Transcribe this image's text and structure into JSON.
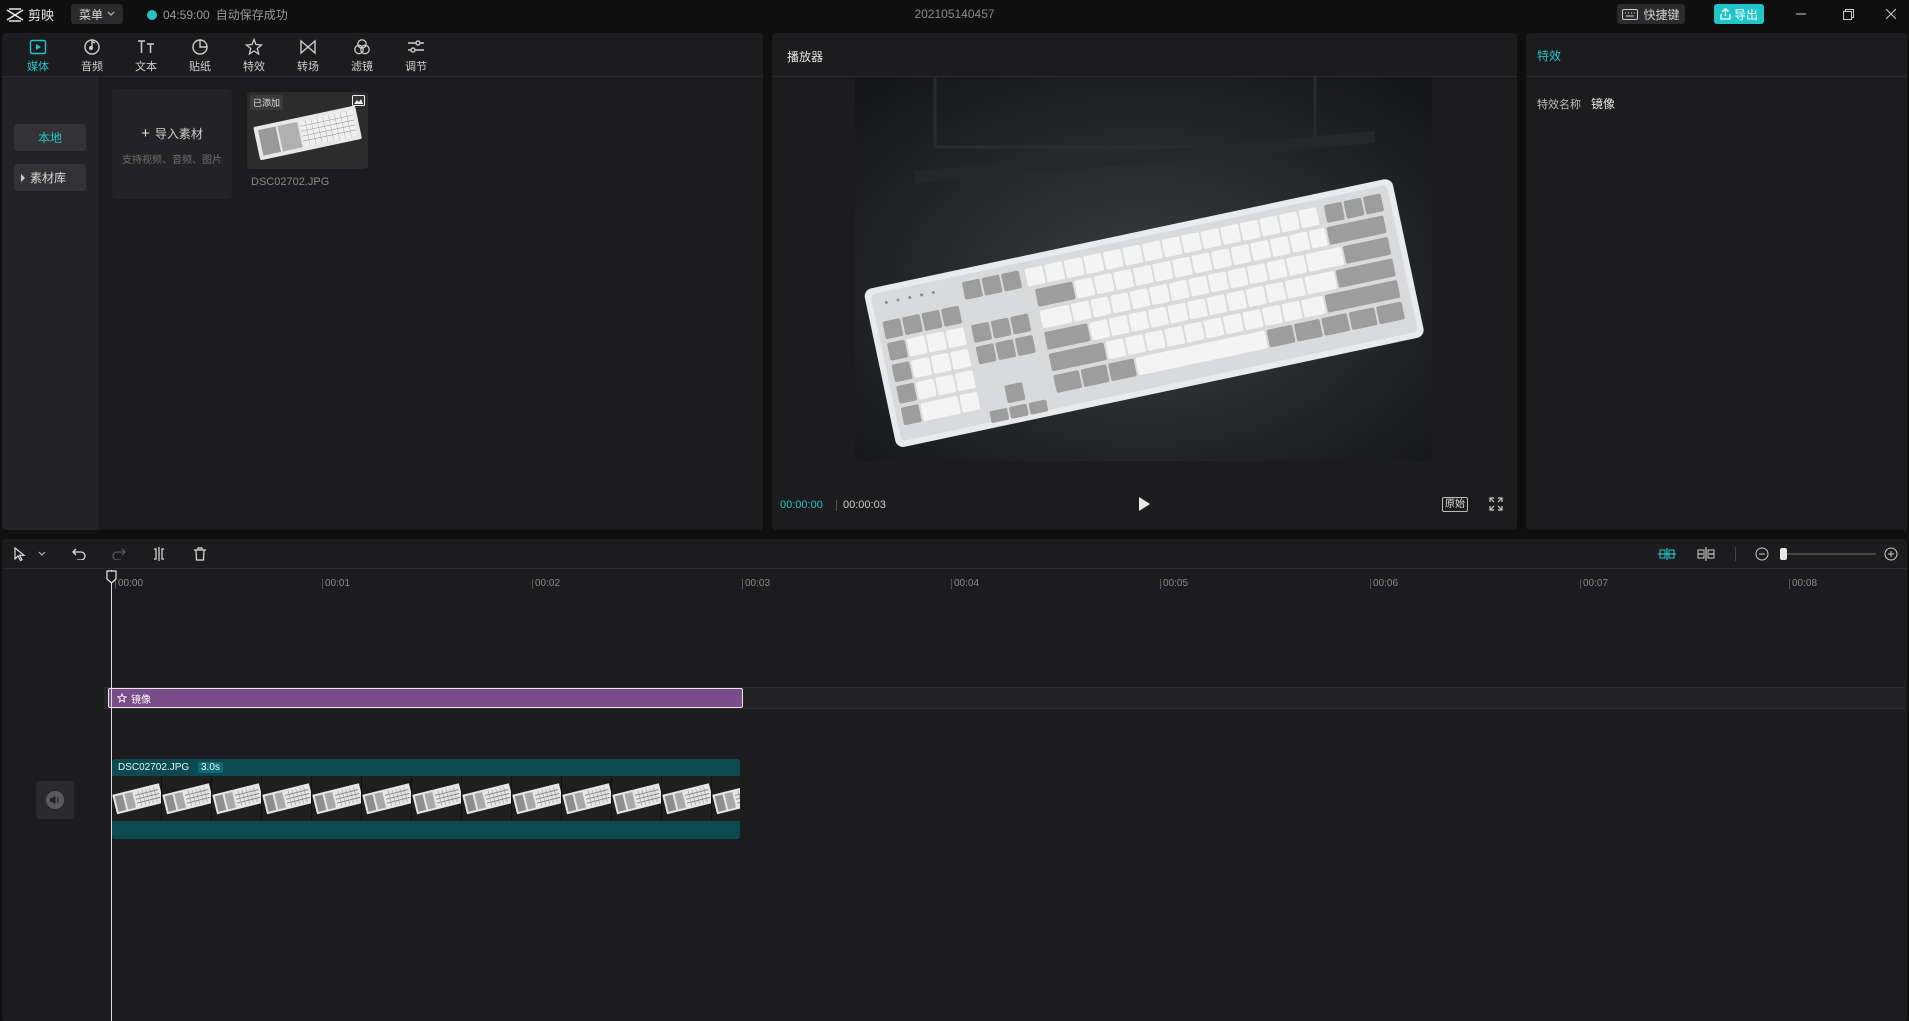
{
  "app": {
    "name": "剪映",
    "menu_label": "菜单",
    "autosave_time": "04:59:00",
    "autosave_text": "自动保存成功",
    "project_title": "202105140457",
    "shortcut_label": "快捷键",
    "export_label": "导出"
  },
  "media_tabs": [
    {
      "label": "媒体",
      "icon": "media-icon",
      "active": true
    },
    {
      "label": "音频",
      "icon": "audio-icon",
      "active": false
    },
    {
      "label": "文本",
      "icon": "text-icon",
      "active": false
    },
    {
      "label": "贴纸",
      "icon": "sticker-icon",
      "active": false
    },
    {
      "label": "特效",
      "icon": "effects-icon",
      "active": false
    },
    {
      "label": "转场",
      "icon": "transition-icon",
      "active": false
    },
    {
      "label": "滤镜",
      "icon": "filter-icon",
      "active": false
    },
    {
      "label": "调节",
      "icon": "adjust-icon",
      "active": false
    }
  ],
  "media_sidebar": {
    "local": "本地",
    "library": "素材库"
  },
  "import_card": {
    "label": "导入素材",
    "hint": "支持视频、音频、图片"
  },
  "media_items": [
    {
      "name": "DSC02702.JPG",
      "badge": "已添加"
    }
  ],
  "player": {
    "title": "播放器",
    "current_time": "00:00:00",
    "total_time": "00:00:03",
    "ratio_label": "原始"
  },
  "inspector": {
    "title": "特效",
    "field_label": "特效名称",
    "field_value": "镜像"
  },
  "timeline": {
    "ticks": [
      "00:00",
      "00:01",
      "00:02",
      "00:03",
      "00:04",
      "00:05",
      "00:06",
      "00:07",
      "00:08"
    ],
    "effect_clip_label": "镜像",
    "video_clip_name": "DSC02702.JPG",
    "video_clip_duration": "3.0s"
  },
  "colors": {
    "accent": "#27c3c8",
    "effect_clip": "#7a4d8a",
    "video_clip": "#0c4a52"
  }
}
